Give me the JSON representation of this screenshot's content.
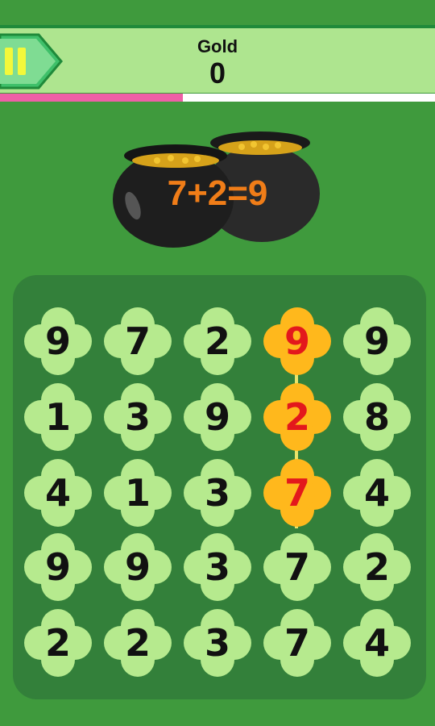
{
  "header": {
    "gold_label": "Gold",
    "gold_value": "0",
    "pause_icon": "pause-icon"
  },
  "progress": {
    "fraction": 0.42,
    "color": "#ee5fa6"
  },
  "equation": "7+2=9",
  "colors": {
    "clover_normal": "#b6ea8e",
    "clover_selected": "#ffb81c",
    "selected_text": "#e3181c",
    "equation_text": "#f07d18"
  },
  "grid": [
    [
      "9",
      "7",
      "2",
      "9",
      "9"
    ],
    [
      "1",
      "3",
      "9",
      "2",
      "8"
    ],
    [
      "4",
      "1",
      "3",
      "7",
      "4"
    ],
    [
      "9",
      "9",
      "3",
      "7",
      "2"
    ],
    [
      "2",
      "2",
      "3",
      "7",
      "4"
    ]
  ],
  "selected": [
    [
      0,
      3
    ],
    [
      1,
      3
    ],
    [
      2,
      3
    ]
  ]
}
